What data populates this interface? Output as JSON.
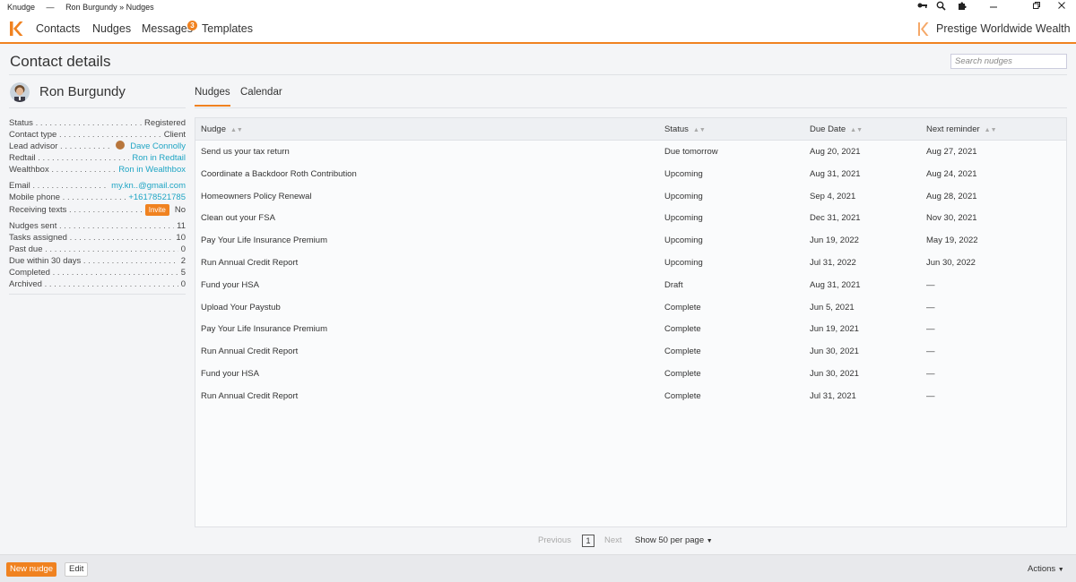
{
  "window": {
    "app_name": "Knudge",
    "separator": "—",
    "title": "Ron Burgundy » Nudges",
    "controls": [
      "key-icon",
      "zoom-icon",
      "extensions-icon",
      "minimize-icon",
      "restore-icon",
      "close-icon"
    ]
  },
  "nav": {
    "items": [
      {
        "label": "Contacts"
      },
      {
        "label": "Nudges"
      },
      {
        "label": "Messages",
        "badge": "3"
      },
      {
        "label": "Templates"
      }
    ],
    "firm_name": "Prestige Worldwide Wealth",
    "accent_color": "#f08220",
    "link_color": "#1fa5c4"
  },
  "page": {
    "title": "Contact details",
    "search_placeholder": "Search nudges"
  },
  "contact": {
    "name": "Ron Burgundy",
    "details": [
      {
        "key": "Status",
        "value": "Registered"
      },
      {
        "key": "Contact type",
        "value": "Client"
      },
      {
        "key": "Lead advisor",
        "value": "Dave Connolly"
      },
      {
        "key": "Redtail",
        "value": "Ron in Redtail"
      },
      {
        "key": "Wealthbox",
        "value": "Ron in Wealthbox"
      }
    ],
    "contact_info": [
      {
        "key": "Email",
        "value": "my.kn..@gmail.com"
      },
      {
        "key": "Mobile phone",
        "value": "+16178521785"
      },
      {
        "key": "Receiving texts",
        "value": "No",
        "action": "Invite"
      }
    ],
    "stats": [
      {
        "key": "Nudges sent",
        "value": "11"
      },
      {
        "key": "Tasks assigned",
        "value": "10"
      },
      {
        "key": "Past due",
        "value": "0"
      },
      {
        "key": "Due within 30 days",
        "value": "2"
      },
      {
        "key": "Completed",
        "value": "5"
      },
      {
        "key": "Archived",
        "value": "0"
      }
    ]
  },
  "tabs": [
    {
      "label": "Nudges",
      "active": true
    },
    {
      "label": "Calendar",
      "active": false
    }
  ],
  "table": {
    "columns": [
      "Nudge",
      "Status",
      "Due Date",
      "Next reminder"
    ],
    "rows": [
      [
        "Send us your tax return",
        "Due tomorrow",
        "Aug 20, 2021",
        "Aug 27, 2021"
      ],
      [
        "Coordinate a Backdoor Roth Contribution",
        "Upcoming",
        "Aug 31, 2021",
        "Aug 24, 2021"
      ],
      [
        "Homeowners Policy Renewal",
        "Upcoming",
        "Sep 4, 2021",
        "Aug 28, 2021"
      ],
      [
        "Clean out your FSA",
        "Upcoming",
        "Dec 31, 2021",
        "Nov 30, 2021"
      ],
      [
        "Pay Your Life Insurance Premium",
        "Upcoming",
        "Jun 19, 2022",
        "May 19, 2022"
      ],
      [
        "Run Annual Credit Report",
        "Upcoming",
        "Jul 31, 2022",
        "Jun 30, 2022"
      ],
      [
        "Fund your HSA",
        "Draft",
        "Aug 31, 2021",
        "—"
      ],
      [
        "Upload Your Paystub",
        "Complete",
        "Jun 5, 2021",
        "—"
      ],
      [
        "Pay Your Life Insurance Premium",
        "Complete",
        "Jun 19, 2021",
        "—"
      ],
      [
        "Run Annual Credit Report",
        "Complete",
        "Jun 30, 2021",
        "—"
      ],
      [
        "Fund your HSA",
        "Complete",
        "Jun 30, 2021",
        "—"
      ],
      [
        "Run Annual Credit Report",
        "Complete",
        "Jul 31, 2021",
        "—"
      ]
    ]
  },
  "pagination": {
    "previous": "Previous",
    "current": "1",
    "next": "Next",
    "per_page": "Show 50 per page"
  },
  "footer": {
    "new_nudge": "New nudge",
    "edit": "Edit",
    "actions": "Actions"
  }
}
